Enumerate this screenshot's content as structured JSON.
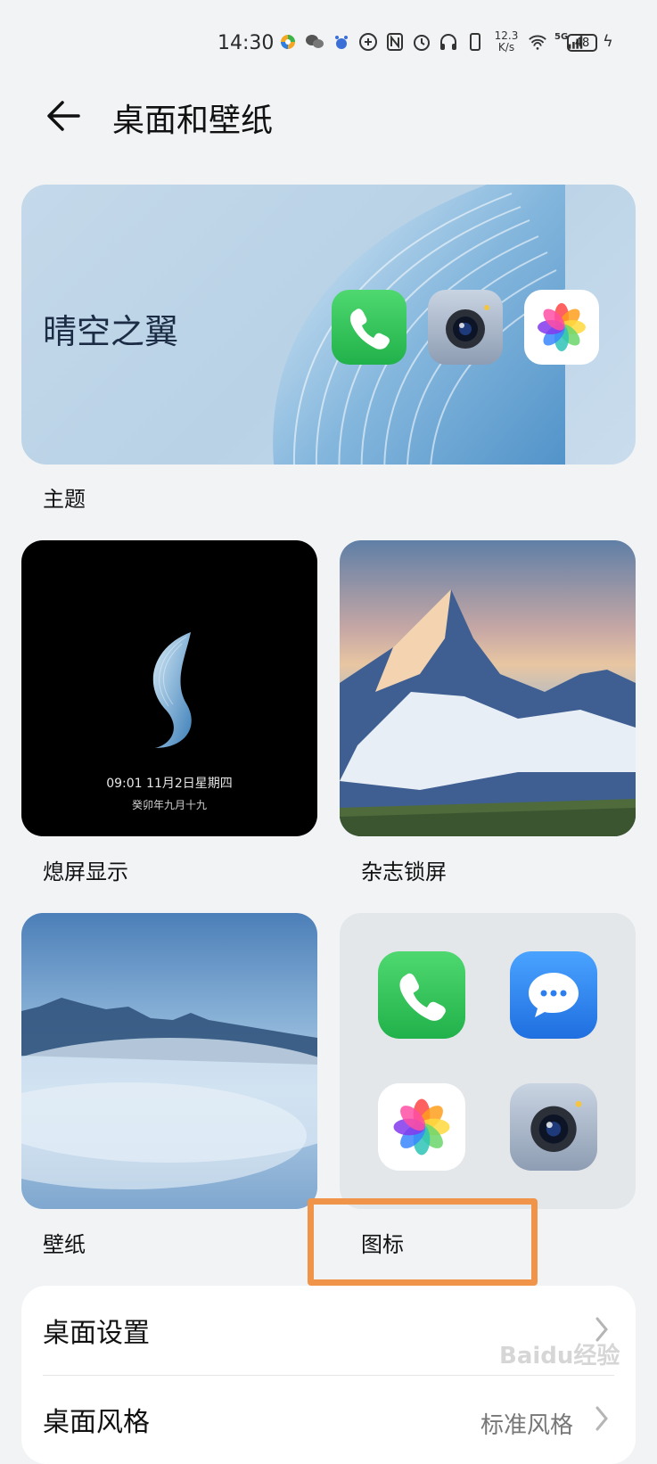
{
  "status_bar": {
    "time": "14:30",
    "net_speed_value": "12.3",
    "net_speed_unit": "K/s",
    "network_type": "5G",
    "battery": "48"
  },
  "header": {
    "title": "桌面和壁纸"
  },
  "theme": {
    "name": "晴空之翼",
    "label": "主题"
  },
  "aod": {
    "time_date": "09:01  11月2日星期四",
    "lunar_date": "癸卯年九月十九",
    "label": "熄屏显示"
  },
  "magazine": {
    "label": "杂志锁屏"
  },
  "wallpaper": {
    "label": "壁纸"
  },
  "icons": {
    "label": "图标"
  },
  "settings": {
    "rows": [
      {
        "label": "桌面设置",
        "value": ""
      },
      {
        "label": "桌面风格",
        "value": "标准风格"
      }
    ]
  },
  "watermark": "Baidu经验",
  "colors": {
    "highlight": "#f0944a",
    "background": "#f1f3f5"
  }
}
